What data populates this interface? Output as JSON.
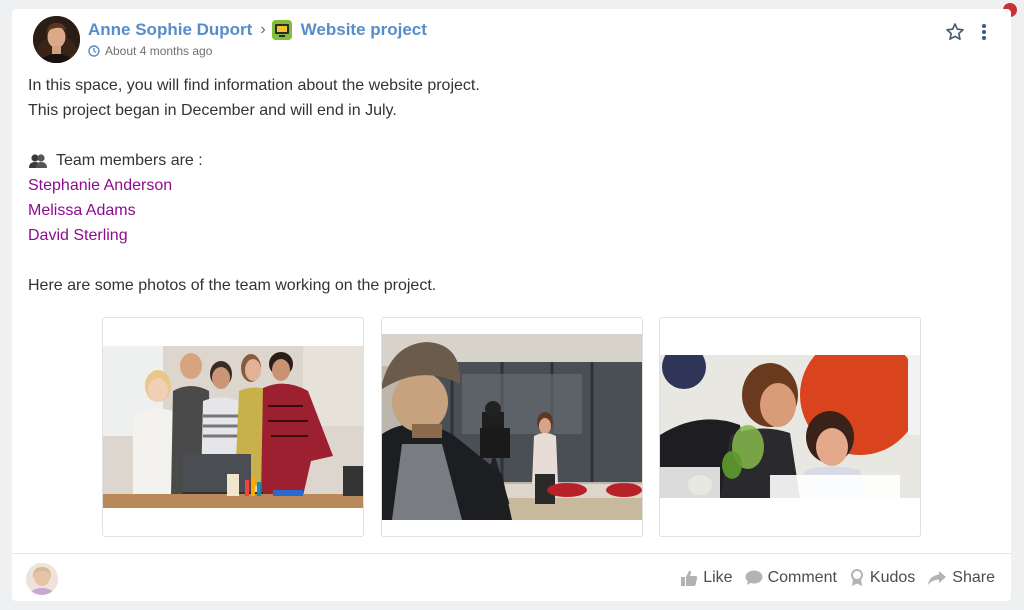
{
  "post": {
    "author": "Anne Sophie Duport",
    "separator": "›",
    "space": "Website project",
    "timestamp": "About 4 months ago",
    "lines": [
      "In this space, you will find information about the website project.",
      "This project began in December and will end in July."
    ],
    "team_label": "Team members are :",
    "members": [
      "Stephanie Anderson",
      "Melissa Adams",
      "David Sterling"
    ],
    "photos_caption": "Here are some photos of the team working on the project."
  },
  "actions": {
    "like": "Like",
    "comment": "Comment",
    "kudos": "Kudos",
    "share": "Share"
  },
  "icons": {
    "favorite": "star-outline-icon",
    "menu": "kebab-menu-icon",
    "clock": "clock-icon",
    "team": "people-icon"
  },
  "colors": {
    "author_link": "#578dc9",
    "member_link": "#8e0b8e",
    "notification": "#c83232"
  }
}
